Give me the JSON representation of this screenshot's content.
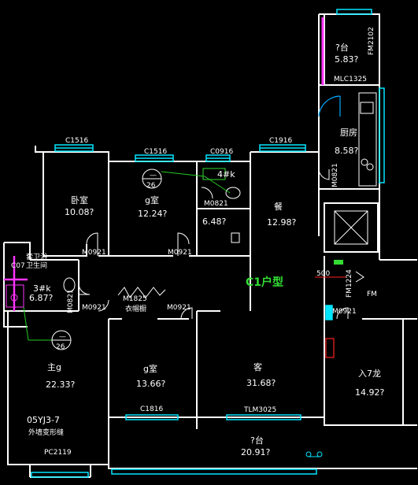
{
  "plan_title": "C1户型",
  "rooms": [
    {
      "id": "balcony-ne",
      "name": "?台",
      "area": "5.83?"
    },
    {
      "id": "kitchen",
      "name": "厨房",
      "area": "8.58?"
    },
    {
      "id": "bedroom-nw",
      "name": "卧室",
      "area": "10.08?"
    },
    {
      "id": "bedroom-n",
      "name": "g室",
      "area": "12.24?"
    },
    {
      "id": "bath-small",
      "name": "4#k",
      "area": "6.48?"
    },
    {
      "id": "dining",
      "name": "餐",
      "area": "12.98?"
    },
    {
      "id": "bath-west",
      "name": "3#k",
      "area": "6.87?"
    },
    {
      "id": "master-bedroom",
      "name": "主g",
      "area": "22.33?"
    },
    {
      "id": "bedroom-s",
      "name": "g室",
      "area": "13.66?"
    },
    {
      "id": "living",
      "name": "客",
      "area": "31.68?"
    },
    {
      "id": "entrance",
      "name": "入7龙",
      "area": "14.92?"
    },
    {
      "id": "balcony-s",
      "name": "?台",
      "area": "20.91?"
    }
  ],
  "labels": {
    "c1516_a": "C1516",
    "c1516_b": "C1516",
    "c0916": "C0916",
    "c1916": "C1916",
    "fm2102": "FM2102",
    "mlc1325": "MLC1325",
    "m0821_kitchen": "M0821",
    "m0821_bath": "M0821",
    "m0921_a": "M0921",
    "m0921_b": "M0921",
    "m0921_c": "M0921",
    "m0921_d": "M0921",
    "m0921_e": "M0921",
    "m0921_f": "M0921",
    "m0821_west": "M0821",
    "m1825": "M1825",
    "wardrobe": "衣帽橱",
    "fm1224": "FM1224",
    "dim_500": "500",
    "fm": "FM",
    "co7": "C07",
    "bath_label": "卫生间",
    "bath_label2": "套卫浴",
    "c1816": "C1816",
    "tlm3025": "TLM3025",
    "pc2119": "PC2119",
    "note_line1": "05YJ3-7",
    "note_line2": "外墙变形缝",
    "callout_a_top": "—",
    "callout_a_bottom": "26",
    "callout_b_top": "—",
    "callout_b_bottom": "26"
  },
  "colors": {
    "wall": "#ffffff",
    "window": "#00e5ff",
    "door": "#ff33ff",
    "stair": "#ffffff",
    "red": "#ff2222",
    "green": "#33dd33",
    "callout_green": "#22cc22"
  }
}
